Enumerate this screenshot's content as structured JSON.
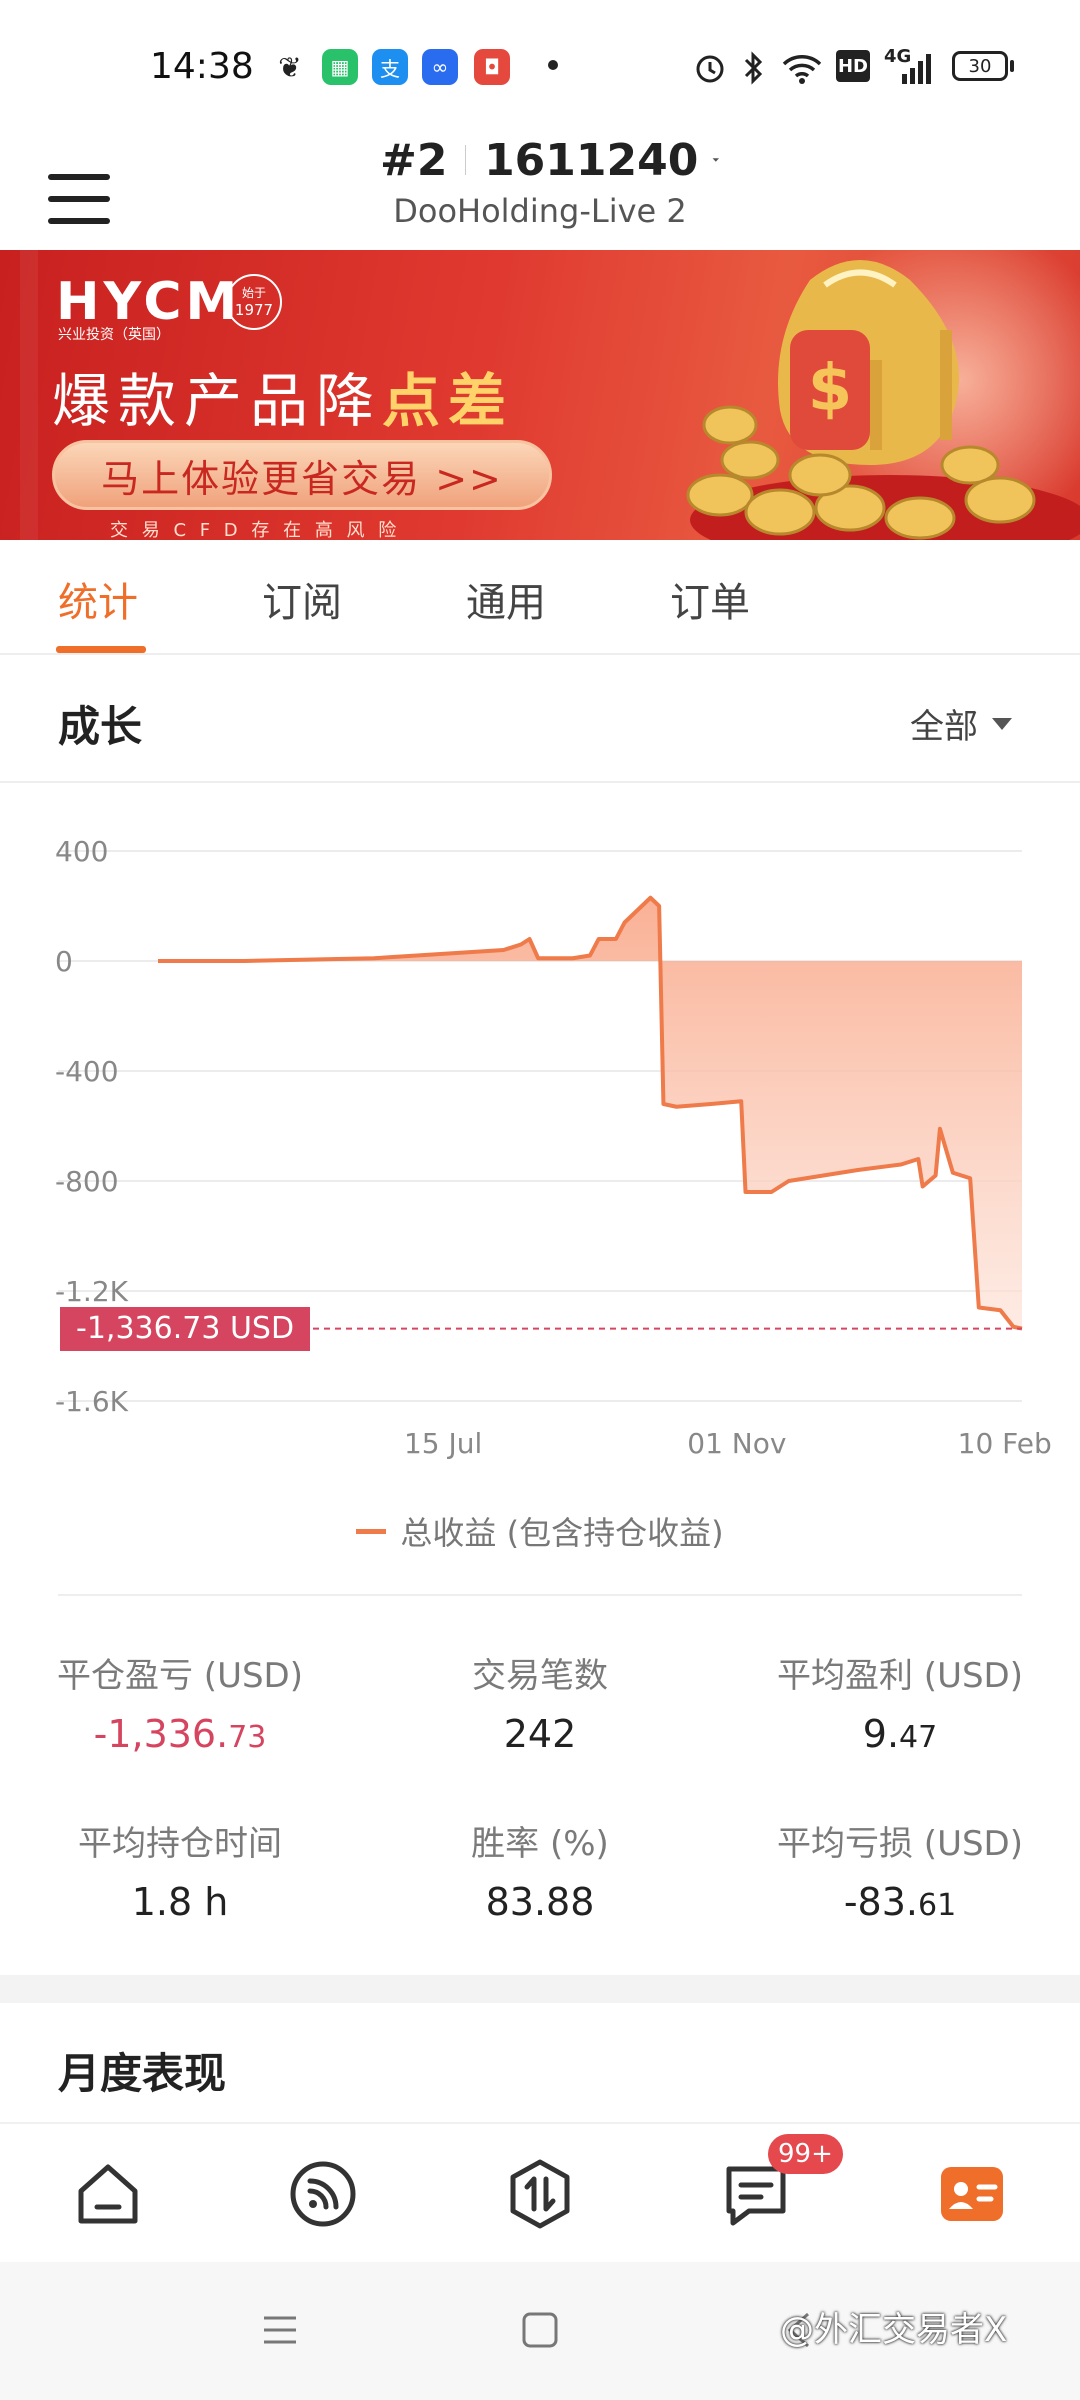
{
  "status_bar": {
    "time": "14:38",
    "battery": "30",
    "network": "4G"
  },
  "header": {
    "account_prefix": "#2",
    "account_number": "1611240",
    "account_name": "DooHolding-Live 2"
  },
  "banner": {
    "brand": "HYCM",
    "brand_sub": "兴业投资（英国）",
    "seal_line1": "始于",
    "seal_line2": "1977",
    "headline_main": "爆款产品降",
    "headline_highlight": "点差",
    "cta": "马上体验更省交易 >>",
    "disclaimer": "交 易 C F D 存 在 高 风 险"
  },
  "tabs": [
    {
      "label": "统计",
      "active": true
    },
    {
      "label": "订阅",
      "active": false
    },
    {
      "label": "通用",
      "active": false
    },
    {
      "label": "订单",
      "active": false
    }
  ],
  "growth": {
    "title": "成长",
    "filter": "全部"
  },
  "chart_data": {
    "type": "area",
    "y_ticks": [
      "400",
      "0",
      "-400",
      "-800",
      "-1.2K",
      "-1.6K"
    ],
    "ylim": [
      -1600,
      400
    ],
    "x_ticks": [
      "15 Jul",
      "01 Nov",
      "10 Feb"
    ],
    "current_value_label": "-1,336.73 USD",
    "current_value": -1336.73,
    "series": [
      {
        "name": "总收益 (包含持仓收益)",
        "color": "#ef7a4a",
        "points": [
          [
            0,
            0
          ],
          [
            0.1,
            0
          ],
          [
            0.25,
            10
          ],
          [
            0.35,
            30
          ],
          [
            0.4,
            40
          ],
          [
            0.42,
            60
          ],
          [
            0.43,
            80
          ],
          [
            0.44,
            10
          ],
          [
            0.48,
            10
          ],
          [
            0.5,
            20
          ],
          [
            0.51,
            80
          ],
          [
            0.53,
            80
          ],
          [
            0.54,
            140
          ],
          [
            0.56,
            200
          ],
          [
            0.57,
            230
          ],
          [
            0.58,
            200
          ],
          [
            0.585,
            -520
          ],
          [
            0.6,
            -530
          ],
          [
            0.64,
            -520
          ],
          [
            0.675,
            -510
          ],
          [
            0.68,
            -840
          ],
          [
            0.71,
            -840
          ],
          [
            0.73,
            -800
          ],
          [
            0.77,
            -780
          ],
          [
            0.81,
            -760
          ],
          [
            0.86,
            -740
          ],
          [
            0.88,
            -720
          ],
          [
            0.885,
            -820
          ],
          [
            0.9,
            -780
          ],
          [
            0.905,
            -610
          ],
          [
            0.92,
            -770
          ],
          [
            0.94,
            -790
          ],
          [
            0.95,
            -1260
          ],
          [
            0.975,
            -1270
          ],
          [
            0.99,
            -1330
          ],
          [
            1.0,
            -1336.73
          ]
        ]
      }
    ]
  },
  "stats": {
    "rows": [
      [
        {
          "label": "平仓盈亏 (USD)",
          "value_main": "-1,336.",
          "value_small": "73",
          "color": "#d64560"
        },
        {
          "label": "交易笔数",
          "value_main": "242",
          "value_small": "",
          "color": "#222222"
        },
        {
          "label": "平均盈利 (USD)",
          "value_main": "9.",
          "value_small": "47",
          "color": "#222222"
        }
      ],
      [
        {
          "label": "平均持仓时间",
          "value_main": "1.8 h",
          "value_small": "",
          "color": "#222222"
        },
        {
          "label": "胜率 (%)",
          "value_main": "83.88",
          "value_small": "",
          "color": "#222222"
        },
        {
          "label": "平均亏损 (USD)",
          "value_main": "-83.",
          "value_small": "61",
          "color": "#222222"
        }
      ]
    ]
  },
  "monthly": {
    "title": "月度表现"
  },
  "bottom_nav": {
    "items": [
      {
        "icon": "home-icon"
      },
      {
        "icon": "feed-icon"
      },
      {
        "icon": "trade-icon"
      },
      {
        "icon": "messages-icon",
        "badge": "99+"
      },
      {
        "icon": "profile-card-icon",
        "active": true
      }
    ]
  },
  "watermark": "@外汇交易者X",
  "colors": {
    "accent": "#ef6e2a",
    "negative": "#d64560",
    "banner_red": "#d8302a",
    "gold": "#f3c04d"
  }
}
